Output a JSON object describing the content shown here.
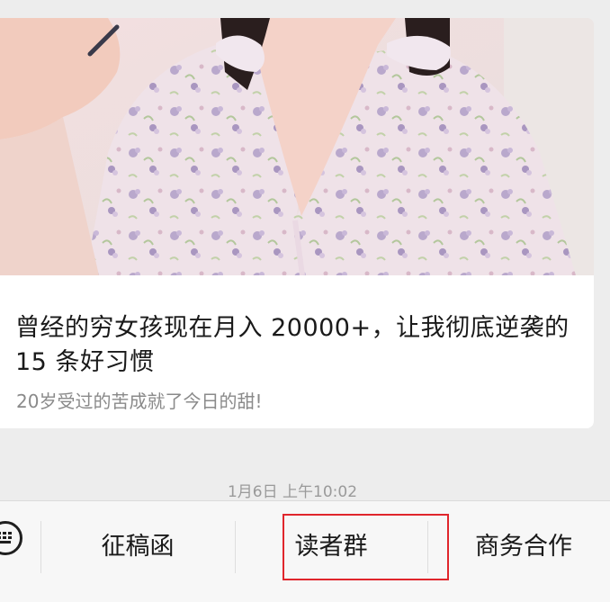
{
  "article": {
    "headline": "曾经的穷女孩现在月入 20000+，让我彻底逆袭的 15 条好习惯",
    "subtitle": "20岁受过的苦成就了今日的甜!"
  },
  "timestamp": "1月6日 上午10:02",
  "menu": {
    "keyboard_icon": "keyboard-icon",
    "items": [
      {
        "label": "征稿函"
      },
      {
        "label": "读者群"
      },
      {
        "label": "商务合作"
      }
    ]
  },
  "colors": {
    "background": "#ededed",
    "card": "#ffffff",
    "highlight": "#e0262c",
    "subtitle": "#8a8a8a"
  }
}
